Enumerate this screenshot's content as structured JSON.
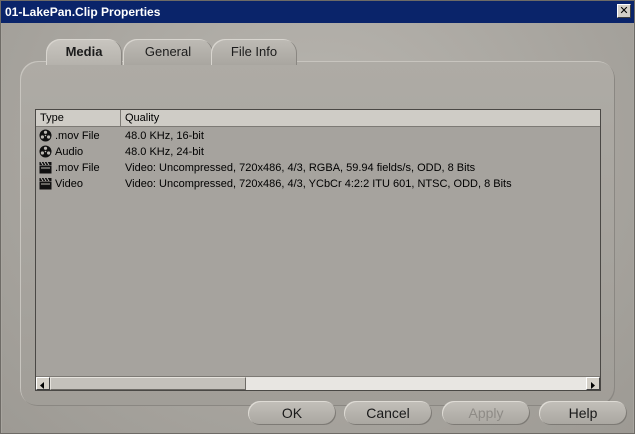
{
  "window": {
    "title": "01-LakePan.Clip Properties",
    "close_glyph": "✕"
  },
  "tabs": [
    {
      "label": "Media",
      "active": true
    },
    {
      "label": "General",
      "active": false
    },
    {
      "label": "File Info",
      "active": false
    }
  ],
  "list": {
    "columns": [
      "Type",
      "Quality"
    ],
    "rows": [
      {
        "type": ".mov File",
        "quality": "48.0 KHz, 16-bit",
        "icon": "audio-reel-icon"
      },
      {
        "type": "Audio",
        "quality": "48.0 KHz, 24-bit",
        "icon": "audio-reel-icon"
      },
      {
        "type": ".mov File",
        "quality": "Video: Uncompressed, 720x486, 4/3, RGBA, 59.94 fields/s, ODD, 8 Bits",
        "icon": "video-clapper-icon"
      },
      {
        "type": "Video",
        "quality": "Video: Uncompressed, 720x486, 4/3, YCbCr 4:2:2 ITU 601, NTSC, ODD, 8 Bits",
        "icon": "video-clapper-icon"
      }
    ]
  },
  "buttons": {
    "ok": "OK",
    "cancel": "Cancel",
    "apply": "Apply",
    "help": "Help"
  }
}
